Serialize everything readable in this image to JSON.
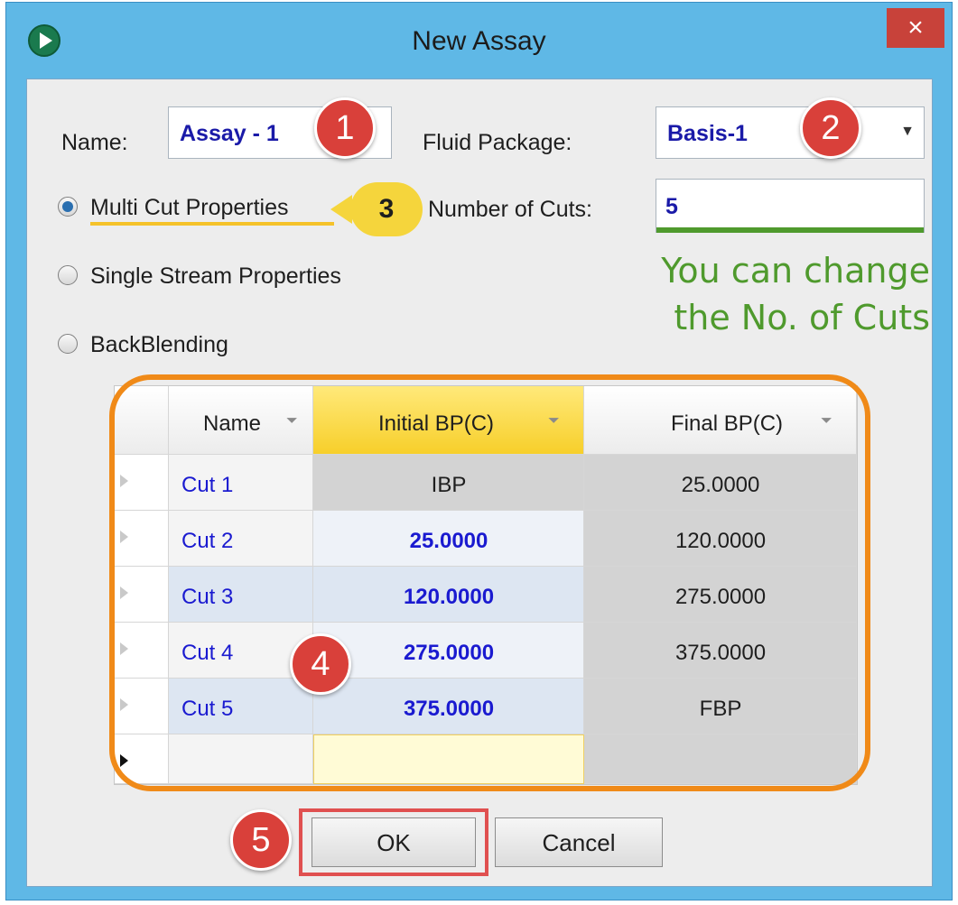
{
  "window": {
    "title": "New Assay",
    "close_symbol": "×"
  },
  "form": {
    "name_label": "Name:",
    "name_value": "Assay - 1",
    "fluid_package_label": "Fluid Package:",
    "fluid_package_value": "Basis-1",
    "dropdown_symbol": "▼",
    "number_of_cuts_label": "Number of Cuts:",
    "number_of_cuts_value": "5"
  },
  "radios": [
    {
      "label": "Multi Cut Properties",
      "checked": true
    },
    {
      "label": "Single Stream Properties",
      "checked": false
    },
    {
      "label": "BackBlending",
      "checked": false
    }
  ],
  "note": {
    "line1": "You can change",
    "line2": "the No. of Cuts"
  },
  "markers": {
    "m1": "1",
    "m2": "2",
    "m3": "3",
    "m4": "4",
    "m5": "5"
  },
  "grid": {
    "headers": {
      "name": "Name",
      "initial": "Initial BP(C)",
      "final": "Final BP(C)"
    },
    "filter_symbol": "⏷",
    "rows": [
      {
        "name": "Cut 1",
        "initial": "IBP",
        "final": "25.0000"
      },
      {
        "name": "Cut 2",
        "initial": "25.0000",
        "final": "120.0000"
      },
      {
        "name": "Cut 3",
        "initial": "120.0000",
        "final": "275.0000"
      },
      {
        "name": "Cut 4",
        "initial": "275.0000",
        "final": "375.0000"
      },
      {
        "name": "Cut 5",
        "initial": "375.0000",
        "final": "FBP"
      }
    ]
  },
  "buttons": {
    "ok": "OK",
    "cancel": "Cancel"
  },
  "colors": {
    "marker_red": "#d9403a",
    "callout_yellow": "#f5d53c",
    "highlight_orange": "#f08a18",
    "note_green": "#4f9a2d"
  }
}
